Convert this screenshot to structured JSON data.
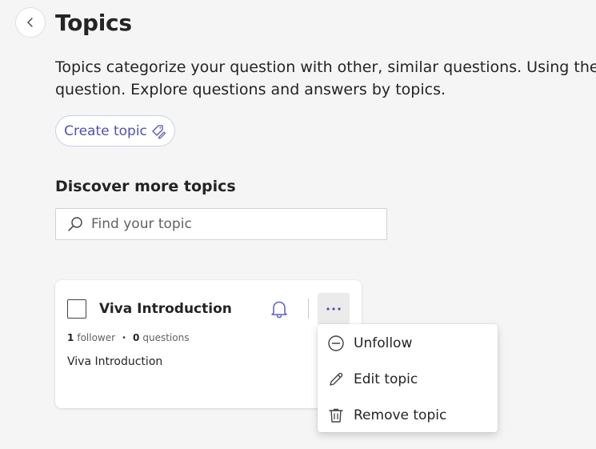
{
  "header": {
    "title": "Topics",
    "back_icon": "chevron-left-icon"
  },
  "intro": {
    "line1": "Topics categorize your question with other, similar questions. Using the right",
    "line2": "question. Explore questions and answers by topics."
  },
  "actions": {
    "create_topic_label": "Create topic",
    "create_topic_icon": "edit-tag-icon"
  },
  "discover": {
    "heading": "Discover more topics",
    "search_placeholder": "Find your topic",
    "search_value": "",
    "search_icon": "search-icon"
  },
  "topic_card": {
    "name": "Viva Introduction",
    "follower_count": "1",
    "follower_label": "follower",
    "question_count": "0",
    "question_label": "questions",
    "separator": "•",
    "description": "Viva Introduction",
    "bell_icon": "bell-icon",
    "more_icon": "more-horizontal-icon"
  },
  "context_menu": {
    "items": [
      {
        "label": "Unfollow",
        "icon": "minus-circle-icon"
      },
      {
        "label": "Edit topic",
        "icon": "pencil-icon"
      },
      {
        "label": "Remove topic",
        "icon": "trash-icon"
      }
    ]
  },
  "colors": {
    "accent": "#4f52b2",
    "background": "#f5f5f5",
    "card": "#ffffff",
    "text": "#242424"
  }
}
